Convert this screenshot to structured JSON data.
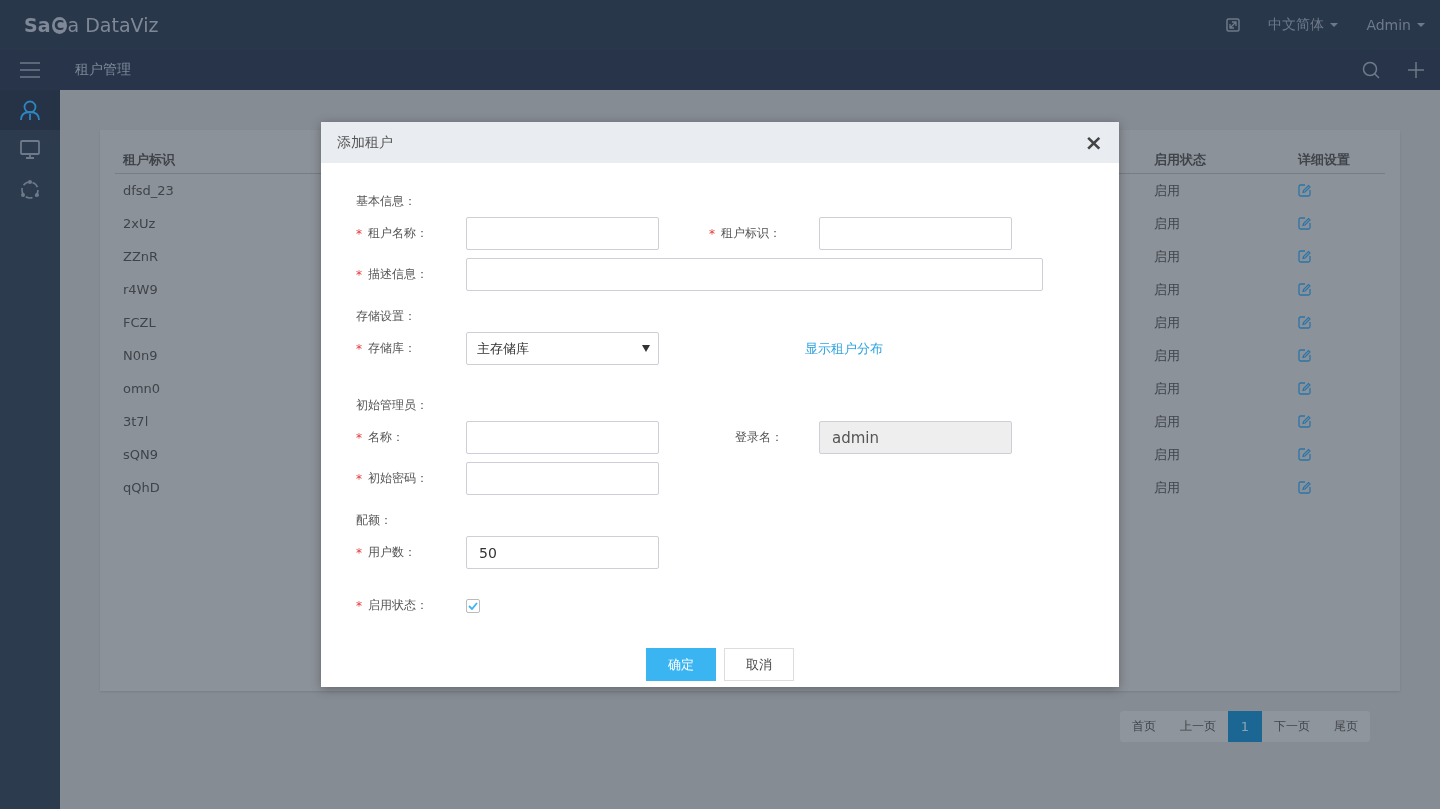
{
  "header": {
    "logo": {
      "prefix": "Sa",
      "mark": "C",
      "suffix": "a DataViz"
    },
    "language": "中文简体",
    "user": "Admin"
  },
  "subbar": {
    "title": "租户管理"
  },
  "sidebar": {
    "items": [
      {
        "kind": "user",
        "selected": true
      },
      {
        "kind": "monitor",
        "selected": false
      },
      {
        "kind": "ring",
        "selected": false
      }
    ]
  },
  "table": {
    "columns": [
      "租户标识",
      "启用状态",
      "详细设置"
    ],
    "rows": [
      {
        "id": "dfsd_23",
        "status": "启用"
      },
      {
        "id": "2xUz",
        "status": "启用"
      },
      {
        "id": "ZZnR",
        "status": "启用"
      },
      {
        "id": "r4W9",
        "status": "启用"
      },
      {
        "id": "FCZL",
        "status": "启用"
      },
      {
        "id": "N0n9",
        "status": "启用"
      },
      {
        "id": "omn0",
        "status": "启用"
      },
      {
        "id": "3t7l",
        "status": "启用"
      },
      {
        "id": "sQN9",
        "status": "启用"
      },
      {
        "id": "qQhD",
        "status": "启用"
      }
    ]
  },
  "pagination": [
    {
      "label": "首页",
      "selected": false
    },
    {
      "label": "上一页",
      "selected": false
    },
    {
      "label": "1",
      "selected": true
    },
    {
      "label": "下一页",
      "selected": false
    },
    {
      "label": "尾页",
      "selected": false
    }
  ],
  "dialog": {
    "title": "添加租户",
    "close": "×",
    "sections": [
      {
        "title": "基本信息：",
        "rows": [
          [
            {
              "kind": "text",
              "label": "租户名称：",
              "marker": "*"
            },
            {
              "kind": "text",
              "label": "租户标识：",
              "marker": "*"
            }
          ],
          [
            {
              "kind": "wide",
              "label": "描述信息：",
              "marker": "*"
            }
          ]
        ]
      },
      {
        "title": "存储设置：",
        "rows": [
          [
            {
              "kind": "select",
              "label": "存储库：",
              "marker": "*",
              "value": "主存储库"
            },
            {
              "kind": "link",
              "label": "显示租户分布"
            }
          ]
        ]
      },
      {
        "title": "初始管理员：",
        "rows": [
          [
            {
              "kind": "text",
              "label": "名称：",
              "marker": "*"
            },
            {
              "kind": "readonly",
              "label": "登录名：",
              "value": "admin"
            }
          ],
          [
            {
              "kind": "text",
              "label": "初始密码：",
              "marker": "*"
            }
          ]
        ]
      },
      {
        "title": "配额：",
        "rows": [
          [
            {
              "kind": "text",
              "label": "用户数：",
              "marker": "*",
              "value": "50"
            }
          ]
        ]
      },
      {
        "rows": [
          [
            {
              "kind": "checkbox",
              "label": "启用状态：",
              "marker": "*",
              "checked": true
            }
          ]
        ]
      }
    ],
    "buttons": [
      {
        "label": "确定",
        "kind": "primary"
      },
      {
        "label": "取消",
        "kind": "default"
      }
    ]
  }
}
